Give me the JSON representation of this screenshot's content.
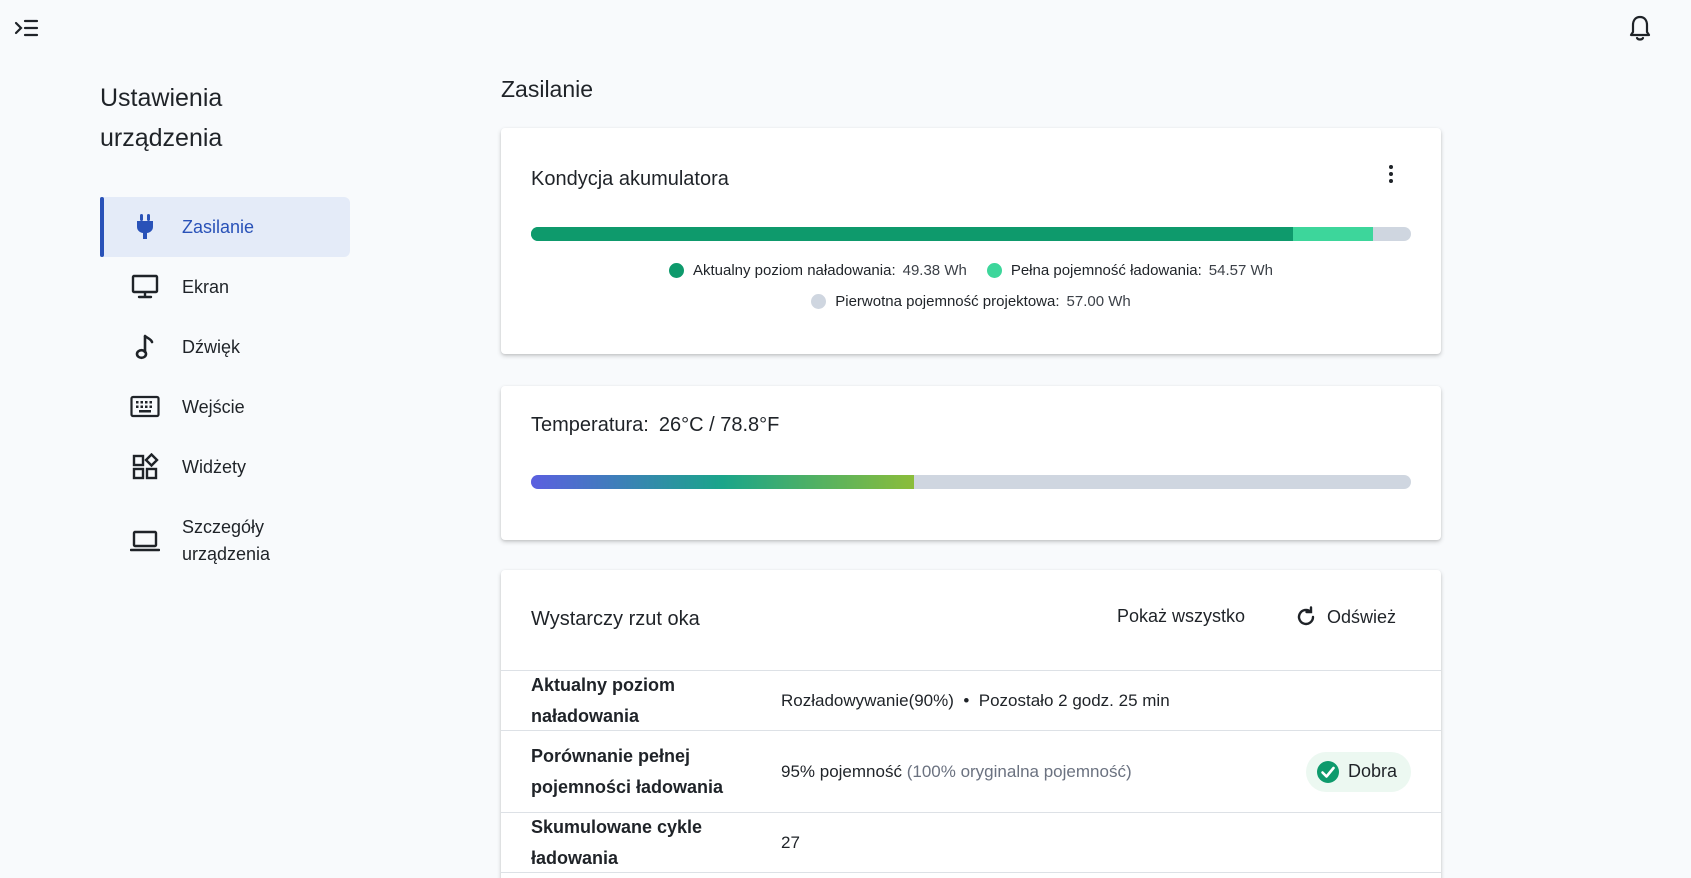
{
  "colors": {
    "accent": "#2952b8",
    "current_charge": "#0e9a6c",
    "full_capacity": "#3dd69b",
    "design_capacity": "#cfd6e0",
    "temp_gradient_start": "#5b5fe0",
    "temp_gradient_end": "#8bbd3a",
    "good_badge": "#0e9a6c"
  },
  "topbar": {
    "menu_icon": "menu-collapse-icon",
    "bell_icon": "bell-icon"
  },
  "sidebar": {
    "title": "Ustawienia\nurządzenia",
    "items": [
      {
        "label": "Zasilanie",
        "icon": "power-plug-icon",
        "active": true
      },
      {
        "label": "Ekran",
        "icon": "monitor-icon"
      },
      {
        "label": "Dźwięk",
        "icon": "music-note-icon"
      },
      {
        "label": "Wejście",
        "icon": "keyboard-icon"
      },
      {
        "label": "Widżety",
        "icon": "widgets-icon"
      },
      {
        "label": "Szczegóły\nurządzenia",
        "icon": "laptop-icon"
      }
    ]
  },
  "main": {
    "title": "Zasilanie",
    "battery": {
      "title": "Kondycja akumulatora",
      "current_label": "Aktualny poziom naładowania:",
      "current_value": "49.38 Wh",
      "current_wh": 49.38,
      "full_label": "Pełna pojemność ładowania:",
      "full_value": "54.57 Wh",
      "full_wh": 54.57,
      "design_label": "Pierwotna pojemność projektowa:",
      "design_value": "57.00 Wh",
      "design_wh": 57.0
    },
    "temperature": {
      "label": "Temperatura:",
      "value": "26°C / 78.8°F",
      "level_fraction": 0.435
    },
    "glance": {
      "title": "Wystarczy rzut oka",
      "show_all": "Pokaż wszystko",
      "refresh": "Odśwież",
      "rows": [
        {
          "key": "Aktualny poziom naładowania",
          "value": "Rozładowywanie(90%)  •  Pozostało 2 godz. 25 min"
        },
        {
          "key": "Porównanie pełnej pojemności ładowania",
          "value": "95% pojemność",
          "value_muted": "(100% oryginalna pojemność)",
          "badge": "Dobra"
        },
        {
          "key": "Skumulowane cykle ładowania",
          "value": "27"
        }
      ]
    }
  }
}
